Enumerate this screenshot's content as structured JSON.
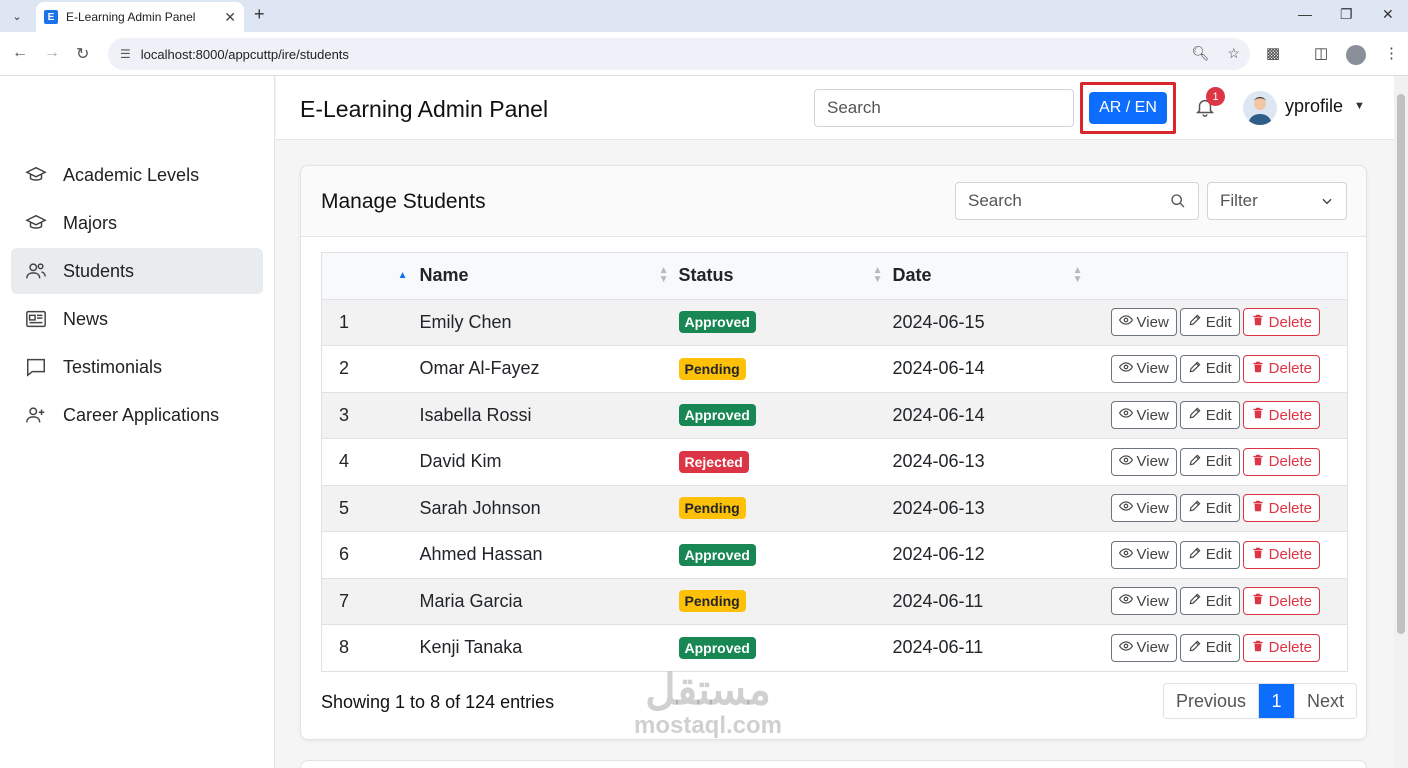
{
  "browser": {
    "tab_title": "E-Learning Admin Panel",
    "favicon_letter": "E",
    "url": "localhost:8000/appcuttp/ire/students"
  },
  "sidebar": {
    "items": [
      {
        "label": "Academic Levels",
        "icon": "graduation-cap-icon",
        "active": false
      },
      {
        "label": "Majors",
        "icon": "graduation-cap-icon",
        "active": false
      },
      {
        "label": "Students",
        "icon": "users-icon",
        "active": true
      },
      {
        "label": "News",
        "icon": "newspaper-icon",
        "active": false
      },
      {
        "label": "Testimonials",
        "icon": "chat-bubble-icon",
        "active": false
      },
      {
        "label": "Career Applications",
        "icon": "user-plus-icon",
        "active": false
      }
    ]
  },
  "header": {
    "title": "E-Learning Admin Panel",
    "search_placeholder": "Search",
    "lang_label": "AR / EN",
    "notification_count": "1",
    "username": "yprofile"
  },
  "main": {
    "title": "Manage Students",
    "search_placeholder": "Search",
    "filter_label": "Filter",
    "columns": [
      "",
      "Name",
      "Status",
      "Date",
      ""
    ],
    "rows": [
      {
        "id": "1",
        "name": "Emily Chen",
        "status": "Approved",
        "date": "2024-06-15"
      },
      {
        "id": "2",
        "name": "Omar Al-Fayez",
        "status": "Pending",
        "date": "2024-06-14"
      },
      {
        "id": "3",
        "name": "Isabella Rossi",
        "status": "Approved",
        "date": "2024-06-14"
      },
      {
        "id": "4",
        "name": "David Kim",
        "status": "Rejected",
        "date": "2024-06-13"
      },
      {
        "id": "5",
        "name": "Sarah Johnson",
        "status": "Pending",
        "date": "2024-06-13"
      },
      {
        "id": "6",
        "name": "Ahmed Hassan",
        "status": "Approved",
        "date": "2024-06-12"
      },
      {
        "id": "7",
        "name": "Maria Garcia",
        "status": "Pending",
        "date": "2024-06-11"
      },
      {
        "id": "8",
        "name": "Kenji Tanaka",
        "status": "Approved",
        "date": "2024-06-11"
      }
    ],
    "actions": {
      "view": "View",
      "edit": "Edit",
      "delete": "Delete"
    },
    "footer_info": "Showing 1 to 8 of 124 entries",
    "pagination": {
      "previous": "Previous",
      "current": "1",
      "next": "Next"
    }
  },
  "watermark": {
    "arabic": "مستقل",
    "latin": "mostaql.com"
  },
  "colors": {
    "primary": "#0d6efd",
    "approved": "#198754",
    "pending": "#ffc107",
    "rejected": "#dc3545",
    "highlight_border": "#d9262c"
  }
}
